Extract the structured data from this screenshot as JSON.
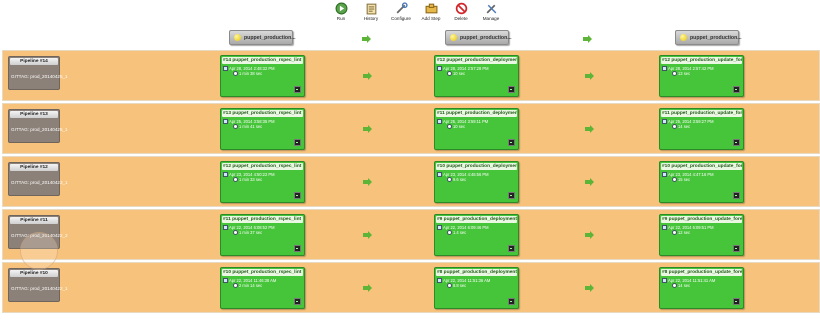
{
  "toolbar": {
    "items": [
      {
        "label": "Run",
        "icon": "run-icon"
      },
      {
        "label": "History",
        "icon": "history-icon"
      },
      {
        "label": "Configure",
        "icon": "configure-icon"
      },
      {
        "label": "Add Step",
        "icon": "add-step-icon"
      },
      {
        "label": "Delete",
        "icon": "delete-icon"
      },
      {
        "label": "Manage",
        "icon": "manage-icon"
      }
    ]
  },
  "stages": [
    {
      "name": "puppet_production..."
    },
    {
      "name": "puppet_production..."
    },
    {
      "name": "puppet_production..."
    }
  ],
  "colors": {
    "row_bg": "#f6c27c",
    "stage_success": "#46c43a",
    "pipeline_box": "#8c8178",
    "arrow": "#5cb536"
  },
  "pipelines": [
    {
      "title": "Pipeline #14",
      "gittag": "GITTAG: prod_20140425_1",
      "stages": [
        {
          "title": "#14 puppet_production_rspec_lint",
          "date": "Apr 28, 2014 2:48:32 PM",
          "duration": "1 min 38 sec"
        },
        {
          "title": "#12 puppet_production_deployment",
          "date": "Apr 28, 2014 2:57:28 PM",
          "duration": "10 sec"
        },
        {
          "title": "#12 puppet_production_update_foreman",
          "date": "Apr 28, 2014 2:57:42 PM",
          "duration": "13 sec"
        }
      ]
    },
    {
      "title": "Pipeline #13",
      "gittag": "GITTAG: prod_20140425_1",
      "stages": [
        {
          "title": "#13 puppet_production_rspec_lint",
          "date": "Apr 25, 2014 3:58:35 PM",
          "duration": "1 min 41 sec"
        },
        {
          "title": "#11 puppet_production_deployment",
          "date": "Apr 25, 2014 3:59:11 PM",
          "duration": "10 sec"
        },
        {
          "title": "#11 puppet_production_update_foreman",
          "date": "Apr 25, 2014 3:59:27 PM",
          "duration": "14 sec"
        }
      ]
    },
    {
      "title": "Pipeline #12",
      "gittag": "GITTAG: prod_20140423_1",
      "stages": [
        {
          "title": "#12 puppet_production_rspec_lint",
          "date": "Apr 23, 2014 4:50:22 PM",
          "duration": "1 min 33 sec"
        },
        {
          "title": "#10 puppet_production_deployment",
          "date": "Apr 23, 2014 4:46:56 PM",
          "duration": "9.6 sec"
        },
        {
          "title": "#10 puppet_production_update_foreman",
          "date": "Apr 23, 2014 4:47:16 PM",
          "duration": "15 sec"
        }
      ]
    },
    {
      "title": "Pipeline #11",
      "gittag": "GITTAG: prod_20140422_2",
      "stages": [
        {
          "title": "#11 puppet_production_rspec_lint",
          "date": "Apr 22, 2014 6:08:52 PM",
          "duration": "1 min 37 sec"
        },
        {
          "title": "#9 puppet_production_deployment",
          "date": "Apr 22, 2014 6:09:46 PM",
          "duration": "1.4 sec"
        },
        {
          "title": "#9 puppet_production_update_foreman",
          "date": "Apr 22, 2014 6:09:51 PM",
          "duration": "12 sec"
        }
      ]
    },
    {
      "title": "Pipeline #10",
      "gittag": "GITTAG: prod_20140422_1",
      "stages": [
        {
          "title": "#10 puppet_production_rspec_lint",
          "date": "Apr 22, 2014 11:46:38 AM",
          "duration": "2 min 14 sec"
        },
        {
          "title": "#8 puppet_production_deployment",
          "date": "Apr 22, 2014 11:51:36 AM",
          "duration": "8.8 sec"
        },
        {
          "title": "#8 puppet_production_update_foreman",
          "date": "Apr 22, 2014 11:51:41 AM",
          "duration": "14 sec"
        }
      ]
    }
  ]
}
